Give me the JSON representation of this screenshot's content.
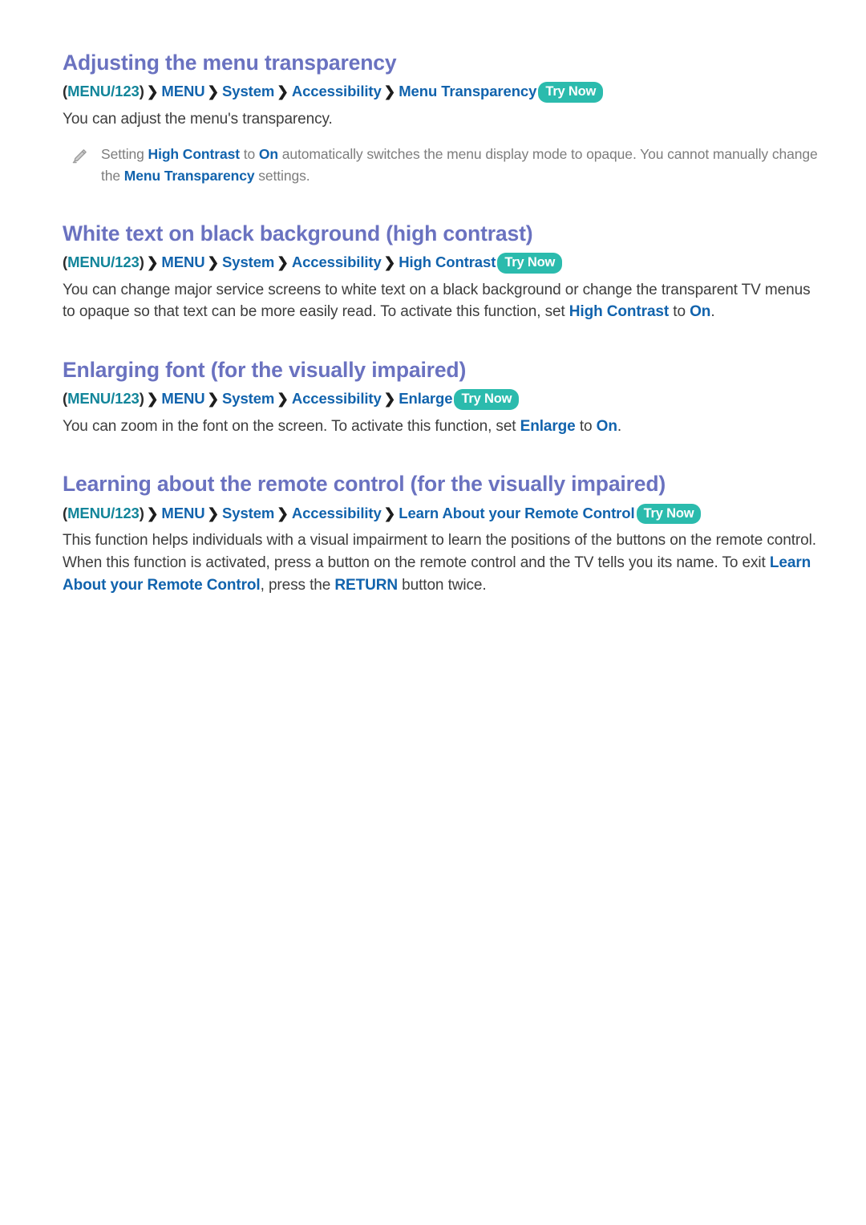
{
  "document": {
    "background_color": "#ffffff",
    "heading_color": "#6a72c0",
    "link_color": "#1163ad",
    "menu_key_color": "#12859a",
    "badge_color": "#2bbbad",
    "body_color": "#3d3d3d",
    "note_color": "#7d7d7d"
  },
  "sections": [
    {
      "heading": "Adjusting the menu transparency",
      "breadcrumb": {
        "open_paren": "(",
        "menu_key": "MENU/123",
        "close_paren": ")",
        "separator": "❯",
        "crumbs": [
          "MENU",
          "System",
          "Accessibility",
          "Menu Transparency"
        ],
        "badge": "Try Now"
      },
      "body": "You can adjust the menu's transparency.",
      "note": {
        "icon": "pencil-icon",
        "text_1": "Setting ",
        "em_1": "High Contrast",
        "text_2": " to ",
        "em_2": "On",
        "text_3": " automatically switches the menu display mode to opaque. You cannot manually change the ",
        "em_3": "Menu Transparency",
        "text_4": " settings."
      }
    },
    {
      "heading": "White text on black background (high contrast)",
      "breadcrumb": {
        "open_paren": "(",
        "menu_key": "MENU/123",
        "close_paren": ")",
        "separator": "❯",
        "crumbs": [
          "MENU",
          "System",
          "Accessibility",
          "High Contrast"
        ],
        "badge": "Try Now"
      },
      "body_1": "You can change major service screens to white text on a black background or change the transparent TV menus to opaque so that text can be more easily read. To activate this function, set ",
      "em_1": "High Contrast",
      "body_2": " to ",
      "em_2": "On",
      "body_3": "."
    },
    {
      "heading": "Enlarging font (for the visually impaired)",
      "breadcrumb": {
        "open_paren": "(",
        "menu_key": "MENU/123",
        "close_paren": ")",
        "separator": "❯",
        "crumbs": [
          "MENU",
          "System",
          "Accessibility",
          "Enlarge"
        ],
        "badge": "Try Now"
      },
      "body_1": "You can zoom in the font on the screen. To activate this function, set ",
      "em_1": "Enlarge",
      "body_2": " to ",
      "em_2": "On",
      "body_3": "."
    },
    {
      "heading": "Learning about the remote control (for the visually impaired)",
      "breadcrumb": {
        "open_paren": "(",
        "menu_key": "MENU/123",
        "close_paren": ")",
        "separator": "❯",
        "crumbs": [
          "MENU",
          "System",
          "Accessibility",
          "Learn About your Remote Control"
        ],
        "badge": "Try Now"
      },
      "body_1": "This function helps individuals with a visual impairment to learn the positions of the buttons on the remote control. When this function is activated, press a button on the remote control and the TV tells you its name. To exit ",
      "em_1": "Learn About your Remote Control",
      "body_2": ", press the ",
      "em_2": "RETURN",
      "body_3": " button twice."
    }
  ]
}
